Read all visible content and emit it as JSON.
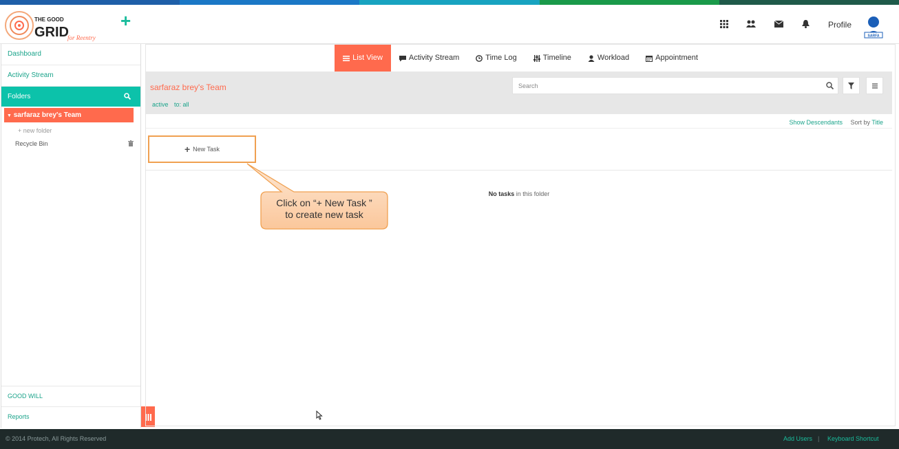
{
  "colors": {
    "accent": "#ff6a4d",
    "teal": "#0cc2aa",
    "link": "#1aa38a",
    "footer_bg": "#1f2a2a",
    "stripe": [
      "#1e5fa8",
      "#1b78c6",
      "#18a3c0",
      "#1a9a4a",
      "#1f5a4a"
    ]
  },
  "header": {
    "logo_text_top": "THE GOOD",
    "logo_text_bottom": "GRID",
    "logo_tagline": "for Reentry",
    "add_icon": "plus-icon",
    "icons": [
      "apps-grid-icon",
      "users-icon",
      "mail-icon",
      "bell-icon"
    ],
    "profile_label": "Profile",
    "avatar_text": "SARFA"
  },
  "sidebar": {
    "dashboard": "Dashboard",
    "activity_stream": "Activity Stream",
    "folders": "Folders",
    "team": "sarfaraz brey's Team",
    "new_folder": "+ new folder",
    "recycle_bin": "Recycle Bin",
    "good_will": "GOOD WILL",
    "reports": "Reports"
  },
  "tabs": [
    {
      "label": "List View",
      "icon": "list-icon",
      "active": true
    },
    {
      "label": "Activity Stream",
      "icon": "comment-icon",
      "active": false
    },
    {
      "label": "Time Log",
      "icon": "clock-icon",
      "active": false
    },
    {
      "label": "Timeline",
      "icon": "sliders-icon",
      "active": false
    },
    {
      "label": "Workload",
      "icon": "user-icon",
      "active": false
    },
    {
      "label": "Appointment",
      "icon": "calendar-icon",
      "active": false
    }
  ],
  "team_bar": {
    "title": "sarfaraz brey's Team",
    "filter_active": "active",
    "filter_to": "to: all",
    "search_placeholder": "Search"
  },
  "sort_row": {
    "show_descendants": "Show Descendants",
    "sort_by": "Sort by",
    "sort_value": "Title"
  },
  "new_task": {
    "label": "New Task"
  },
  "empty": {
    "bold": "No tasks",
    "rest": " in this folder"
  },
  "callout": {
    "line1": "Click on “+ New Task ”",
    "line2": "to create new task"
  },
  "footer": {
    "copyright": "© 2014 Protech, All Rights Reserved",
    "add_users": "Add Users",
    "separator": "|",
    "keyboard_shortcut": "Keyboard Shortcut"
  }
}
